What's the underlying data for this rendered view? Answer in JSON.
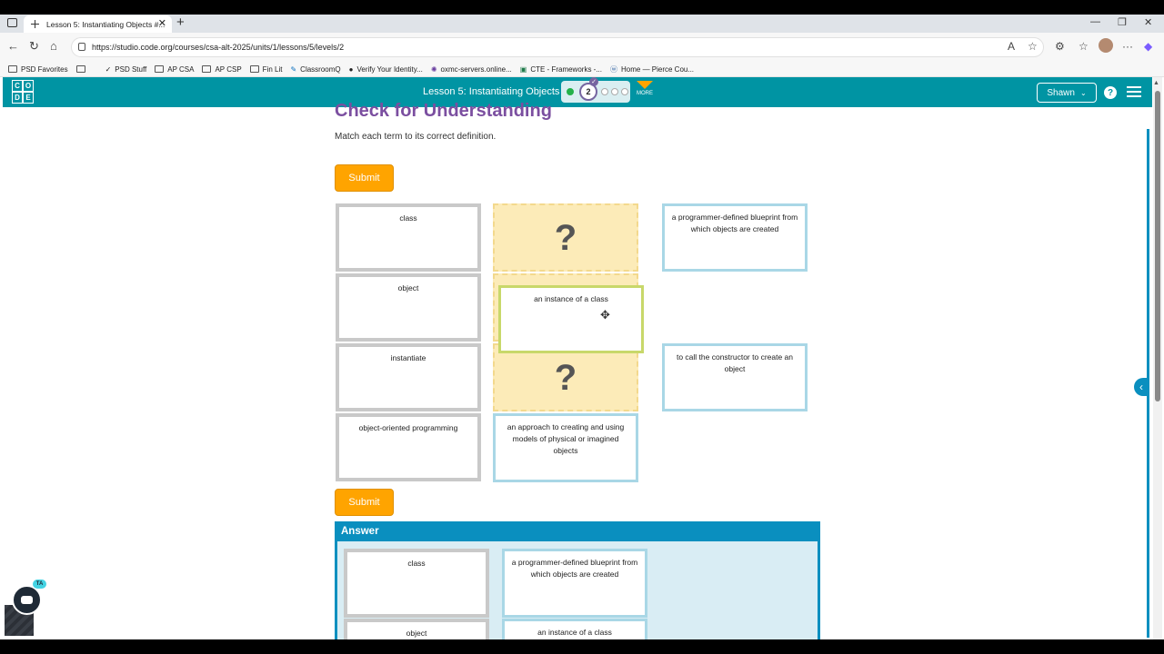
{
  "browser": {
    "tab_title": "Lesson 5: Instantiating Objects #...",
    "url": "https://studio.code.org/courses/csa-alt-2025/units/1/lessons/5/levels/2",
    "bookmarks": [
      "PSD Favorites",
      "PSD Stuff",
      "AP CSA",
      "AP CSP",
      "Fin Lit",
      "ClassroomQ",
      "Verify Your Identity...",
      "oxmc-servers.online...",
      "CTE - Frameworks -...",
      "Home — Pierce Cou..."
    ]
  },
  "header": {
    "logo_letters": [
      "C",
      "O",
      "D",
      "E"
    ],
    "lesson_title": "Lesson 5: Instantiating Objects",
    "current_level": "2",
    "more_label": "MORE",
    "user_name": "Shawn",
    "help_label": "?"
  },
  "main": {
    "title": "Check for Understanding",
    "instructions": "Match each term to its correct definition.",
    "submit_label": "Submit",
    "terms": [
      "class",
      "object",
      "instantiate",
      "object-oriented programming"
    ],
    "slot_placeholder": "?",
    "dragging_card": "an instance of a class",
    "placed_definition": "an approach to creating and using models of physical or imagined objects",
    "available_definitions": [
      "a programmer-defined blueprint from which objects are created",
      "to call the constructor to create an object"
    ]
  },
  "answer": {
    "header": "Answer",
    "rows": [
      {
        "term": "class",
        "definition": "a programmer-defined blueprint from which objects are created"
      },
      {
        "term": "object",
        "definition": "an instance of a class"
      }
    ]
  },
  "widgets": {
    "ta_badge": "TA"
  },
  "colors": {
    "header_teal": "#0094a3",
    "title_purple": "#7b4fa0",
    "submit_orange": "#ffa400",
    "answer_blue": "#0a8fbf"
  }
}
